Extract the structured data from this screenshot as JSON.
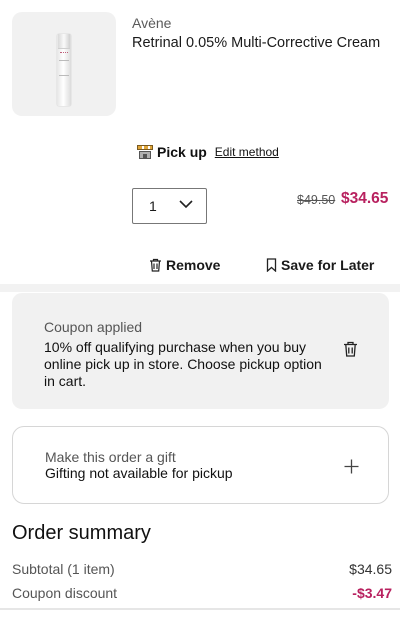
{
  "product": {
    "brand": "Avène",
    "name": "Retrinal 0.05% Multi-Corrective Cream",
    "image_alt": "Avène Retrinal bottle"
  },
  "fulfillment": {
    "icon": "store-icon",
    "label": "Pick up",
    "edit_label": "Edit method"
  },
  "quantity": {
    "value": "1"
  },
  "price": {
    "original": "$49.50",
    "sale": "$34.65",
    "sale_color": "#b8215f"
  },
  "actions": {
    "remove_label": "Remove",
    "save_label": "Save for Later"
  },
  "coupon": {
    "title": "Coupon applied",
    "description": "10% off qualifying purchase when you buy online pick up in store. Choose pickup option in cart."
  },
  "gift": {
    "title": "Make this order a gift",
    "subtitle": "Gifting not available for pickup"
  },
  "summary": {
    "title": "Order summary",
    "rows": [
      {
        "label": "Subtotal (1 item)",
        "value": "$34.65"
      },
      {
        "label": "Coupon discount",
        "value": "-$3.47"
      }
    ]
  }
}
